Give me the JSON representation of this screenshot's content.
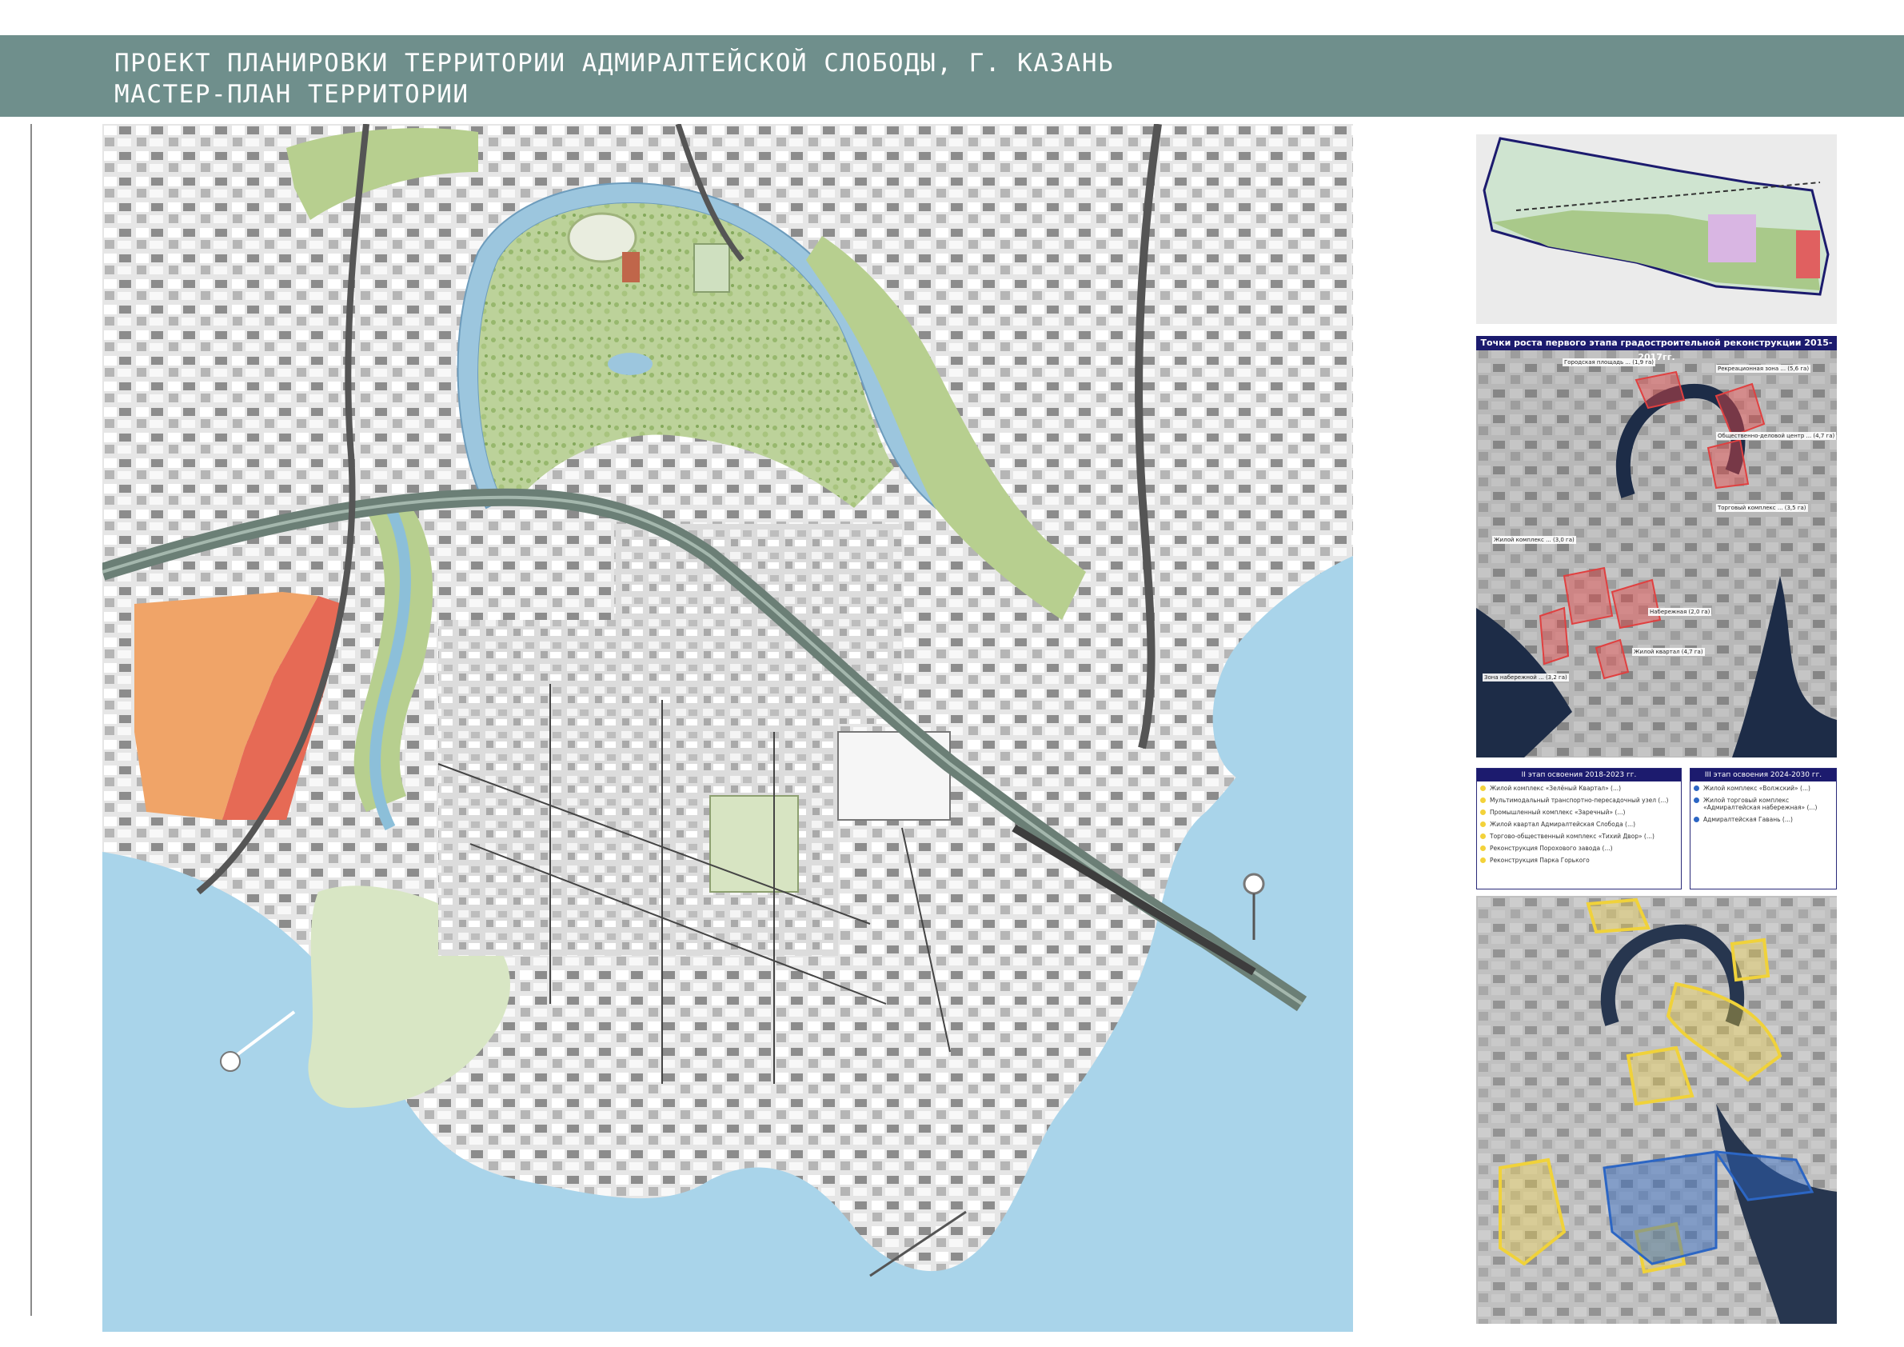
{
  "header": {
    "line1": "ПРОЕКТ ПЛАНИРОВКИ ТЕРРИТОРИИ АДМИРАЛТЕЙСКОЙ СЛОБОДЫ, Г. КАЗАНЬ",
    "line2": "МАСТЕР-ПЛАН ТЕРРИТОРИИ"
  },
  "colors": {
    "header": "#6f8f8c",
    "water": "#a9d4ea",
    "park": "#b7cf8f",
    "city": "#d9d9d9",
    "orange_zone": "#f0a468",
    "red_zone": "#e66a55",
    "highway": "#7a8f86",
    "panel_navy": "#1c1b6e"
  },
  "main_map": {
    "icons": [
      "river-channel",
      "park-area",
      "street-grid",
      "highway-bridge",
      "stadium",
      "pier"
    ]
  },
  "panel_b": {
    "title": "Точки роста первого этапа градостроительной реконструкции 2015-2017гг.",
    "labels": [
      "Городская площадь ... (1,9 га)",
      "Рекреационная зона ... (5,6 га)",
      "Общественно-деловой центр ... (4,7 га)",
      "Торговый комплекс ... (3,5 га)",
      "Жилой комплекс ... (3,0 га)",
      "Набережная (2,0 га)",
      "Жилой квартал (4,7 га)",
      "Зона набережной ... (3,2 га)"
    ]
  },
  "panel_c": {
    "stage2_title": "II этап освоения 2018-2023 гг.",
    "stage3_title": "III этап освоения 2024-2030 гг.",
    "stage2_items": [
      "Жилой комплекс «Зелёный Квартал» (...)",
      "Мультимодальный транспортно-пересадочный узел (...)",
      "Промышленный комплекс «Заречный» (...)",
      "Жилой квартал Адмиралтейская Слобода (...)",
      "Торгово-общественный комплекс «Тихий Двор» (...)",
      "Реконструкция Порохового завода (...)",
      "Реконструкция Парка Горького"
    ],
    "stage3_items": [
      "Жилой комплекс «Волжский» (...)",
      "Жилой торговый комплекс «Адмиралтейская набережная» (...)",
      "Адмиралтейская Гавань (...)"
    ]
  }
}
